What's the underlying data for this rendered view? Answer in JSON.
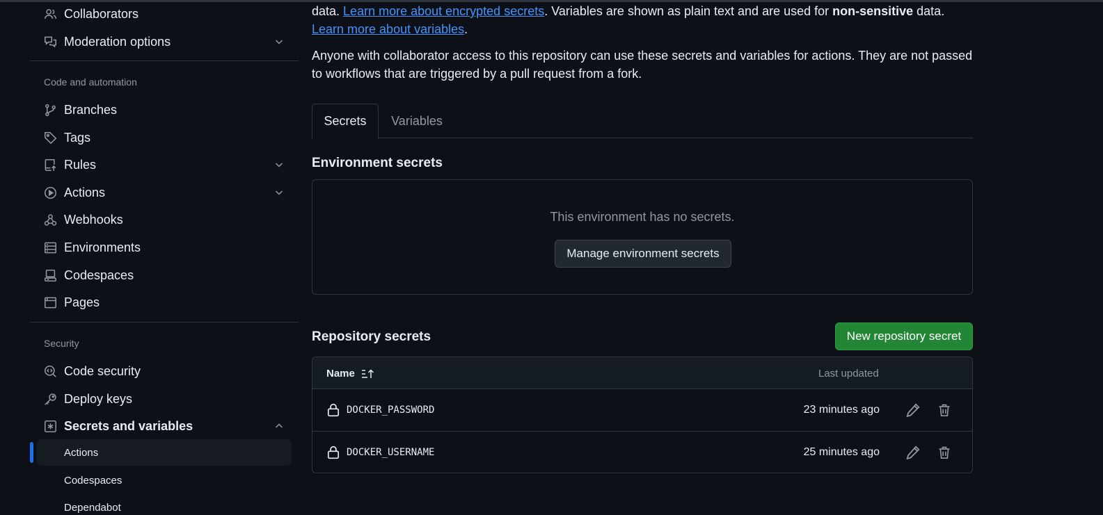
{
  "sidebar": {
    "top_items": [
      {
        "label": "Collaborators",
        "icon": "people-icon"
      },
      {
        "label": "Moderation options",
        "icon": "comment-discussion-icon"
      }
    ],
    "code_automation": {
      "title": "Code and automation",
      "items": [
        {
          "label": "Branches",
          "icon": "git-branch-icon"
        },
        {
          "label": "Tags",
          "icon": "tag-icon"
        },
        {
          "label": "Rules",
          "icon": "repo-push-icon"
        },
        {
          "label": "Actions",
          "icon": "play-icon"
        },
        {
          "label": "Webhooks",
          "icon": "webhook-icon"
        },
        {
          "label": "Environments",
          "icon": "server-icon"
        },
        {
          "label": "Codespaces",
          "icon": "codespaces-icon"
        },
        {
          "label": "Pages",
          "icon": "browser-icon"
        }
      ]
    },
    "security": {
      "title": "Security",
      "items": [
        {
          "label": "Code security",
          "icon": "codescan-icon"
        },
        {
          "label": "Deploy keys",
          "icon": "key-icon"
        },
        {
          "label": "Secrets and variables",
          "icon": "key-asterisk-icon"
        }
      ],
      "sub_items": [
        "Actions",
        "Codespaces",
        "Dependabot"
      ]
    }
  },
  "main": {
    "intro": {
      "p1_a": "data. ",
      "link1": "Learn more about encrypted secrets",
      "p1_b": ". Variables are shown as plain text and are used for ",
      "bold": "non-sensitive",
      "p1_c": " data. ",
      "link2": "Learn more about variables",
      "p1_d": "."
    },
    "paragraph2": "Anyone with collaborator access to this repository can use these secrets and variables for actions. They are not passed to workflows that are triggered by a pull request from a fork.",
    "tabs": [
      "Secrets",
      "Variables"
    ],
    "env_secrets": {
      "title": "Environment secrets",
      "empty_message": "This environment has no secrets.",
      "button": "Manage environment secrets"
    },
    "repo_secrets": {
      "title": "Repository secrets",
      "new_button": "New repository secret",
      "columns": {
        "name": "Name",
        "updated": "Last updated"
      },
      "rows": [
        {
          "name": "DOCKER_PASSWORD",
          "updated": "23 minutes ago"
        },
        {
          "name": "DOCKER_USERNAME",
          "updated": "25 minutes ago"
        }
      ]
    }
  },
  "colors": {
    "background": "#0d1117",
    "border": "#30363d",
    "link": "#4493f8",
    "primary_button": "#238636",
    "active_marker": "#1f6feb",
    "muted_text": "#9198a1"
  }
}
